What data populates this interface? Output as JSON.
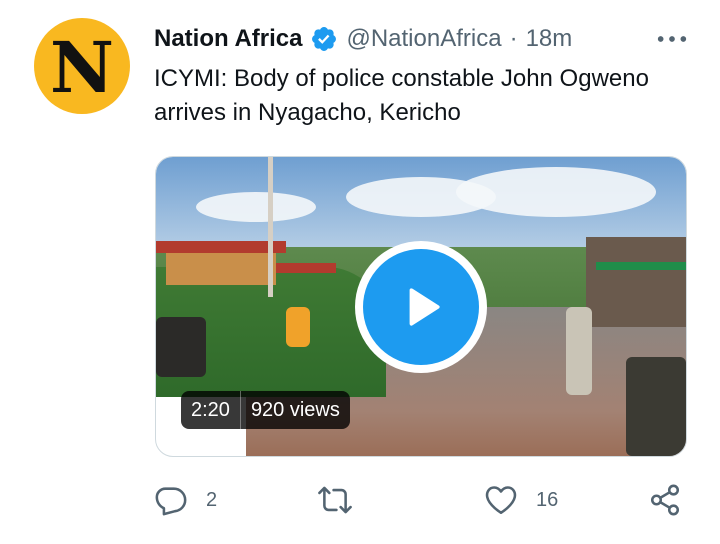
{
  "author": {
    "avatar_letter": "N",
    "name": "Nation Africa",
    "handle": "@NationAfrica",
    "separator": "·",
    "time": "18m",
    "verified_icon": "verified-badge-icon"
  },
  "tweet": {
    "text": "ICYMI: Body of police constable John Ogweno arrives in Nyagacho, Kericho"
  },
  "media": {
    "duration": "2:20",
    "views": "920 views",
    "play_icon": "play-icon"
  },
  "actions": {
    "reply_count": "2",
    "retweet_count": "",
    "like_count": "16",
    "icons": [
      "reply-icon",
      "retweet-icon",
      "like-icon",
      "share-icon"
    ]
  },
  "colors": {
    "accent": "#1d9bf0",
    "secondary_text": "#536471",
    "avatar_bg": "#f9b820"
  }
}
